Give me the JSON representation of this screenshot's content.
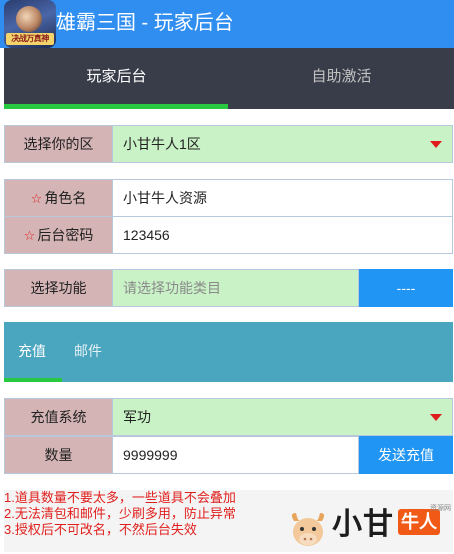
{
  "header": {
    "logo_text": "决战万真神",
    "title": "雄霸三国 - 玩家后台"
  },
  "tabs": [
    {
      "label": "玩家后台",
      "active": true
    },
    {
      "label": "自助激活",
      "active": false
    }
  ],
  "form": {
    "zone": {
      "label": "选择你的区",
      "value": "小甘牛人1区"
    },
    "role": {
      "label": "角色名",
      "required_mark": "☆",
      "value": "小甘牛人资源"
    },
    "password": {
      "label": "后台密码",
      "required_mark": "☆",
      "value": "123456"
    },
    "function": {
      "label": "选择功能",
      "placeholder": "请选择功能类目",
      "button": "----"
    }
  },
  "sub_tabs": [
    {
      "label": "充值",
      "active": true
    },
    {
      "label": "邮件",
      "active": false
    }
  ],
  "recharge": {
    "system": {
      "label": "充值系统",
      "value": "军功"
    },
    "quantity": {
      "label": "数量",
      "value": "9999999"
    },
    "send_button": "发送充值"
  },
  "notes": [
    "1.道具数量不要太多，一些道具不会叠加",
    "2.无法清包和邮件，少刷多用，防止异常",
    "3.授权后不可改名，不然后台失效"
  ],
  "watermark": {
    "text": "小甘",
    "badge": "牛人",
    "tag": "资源网"
  },
  "colors": {
    "header_bg": "#2f8ef0",
    "tabbar_bg": "#393d49",
    "active_underline": "#28c840",
    "label_bg": "#d4b4b4",
    "select_bg": "#c9f2c6",
    "button_bg": "#2195f3",
    "subtab_bg": "#4aa5bf",
    "note_text": "#e0201e"
  }
}
